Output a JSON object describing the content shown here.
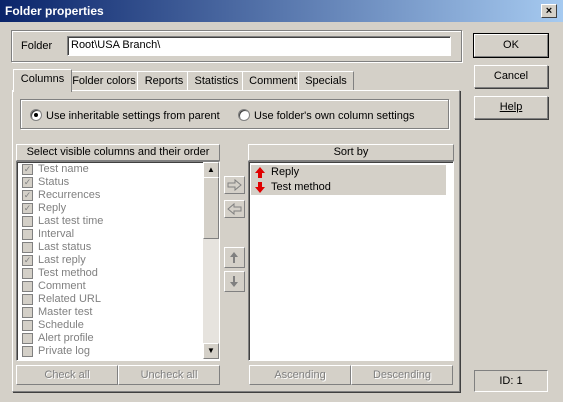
{
  "window": {
    "title": "Folder properties",
    "close_glyph": "×"
  },
  "folder": {
    "label": "Folder",
    "value": "Root\\USA Branch\\"
  },
  "tabs": [
    "Columns",
    "Folder colors",
    "Reports",
    "Statistics",
    "Comment",
    "Specials"
  ],
  "radios": [
    {
      "label": "Use inheritable settings from parent",
      "selected": true
    },
    {
      "label": "Use folder's own column settings",
      "selected": false
    }
  ],
  "columns_panel": {
    "header": "Select visible columns and their order",
    "items": [
      {
        "label": "Test name",
        "checked": true
      },
      {
        "label": "Status",
        "checked": true
      },
      {
        "label": "Recurrences",
        "checked": true
      },
      {
        "label": "Reply",
        "checked": true
      },
      {
        "label": "Last test time",
        "checked": false
      },
      {
        "label": "Interval",
        "checked": false
      },
      {
        "label": "Last status",
        "checked": false
      },
      {
        "label": "Last reply",
        "checked": true
      },
      {
        "label": "Test method",
        "checked": false
      },
      {
        "label": "Comment",
        "checked": false
      },
      {
        "label": "Related URL",
        "checked": false
      },
      {
        "label": "Master test",
        "checked": false
      },
      {
        "label": "Schedule",
        "checked": false
      },
      {
        "label": "Alert profile",
        "checked": false
      },
      {
        "label": "Private log",
        "checked": false
      }
    ],
    "check_all": "Check all",
    "uncheck_all": "Uncheck all"
  },
  "sort_panel": {
    "header": "Sort by",
    "items": [
      {
        "label": "Reply",
        "direction": "ascending"
      },
      {
        "label": "Test method",
        "direction": "descending"
      }
    ],
    "ascending": "Ascending",
    "descending": "Descending"
  },
  "buttons": {
    "ok": "OK",
    "cancel": "Cancel",
    "help": "Help"
  },
  "id_label": "ID: 1",
  "colors": {
    "arrow_red": "#e00000",
    "title_start": "#0a246a",
    "title_end": "#a6caf0"
  }
}
